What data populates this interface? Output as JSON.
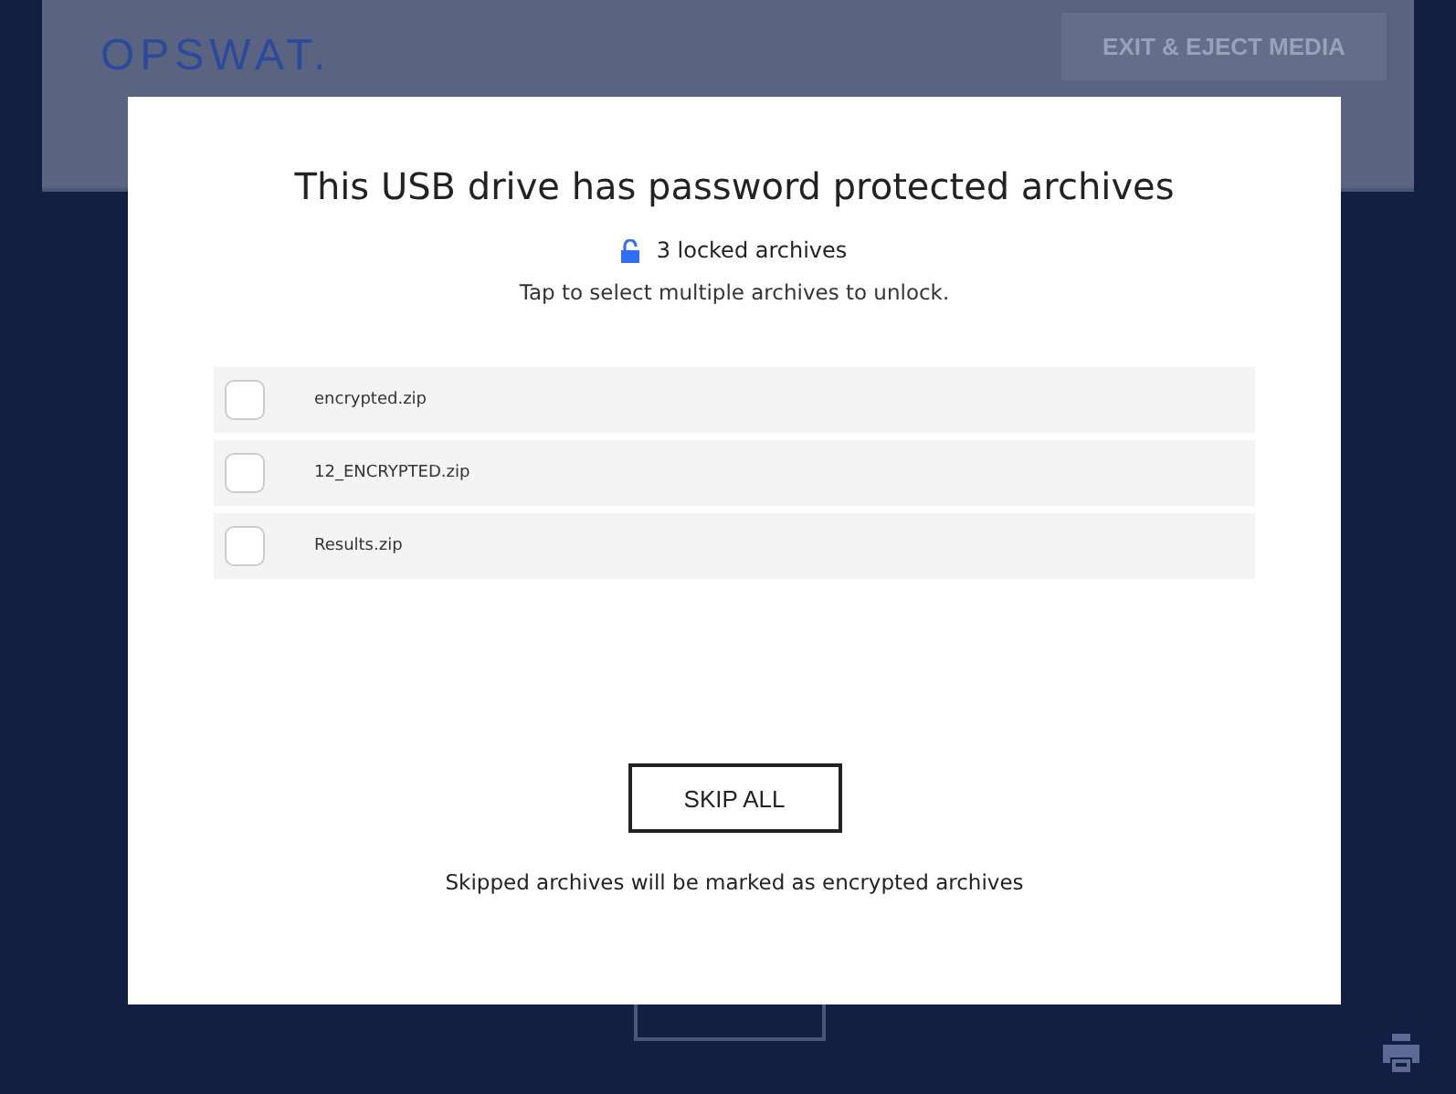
{
  "header": {
    "logo": "OPSWAT.",
    "exit_button": "EXIT & EJECT MEDIA"
  },
  "dialog": {
    "title": "This USB drive has password protected archives",
    "locked_count": "3 locked archives",
    "instruction": "Tap to select multiple archives to unlock.",
    "archives": [
      {
        "name": "encrypted.zip",
        "checked": false
      },
      {
        "name": "12_ENCRYPTED.zip",
        "checked": false
      },
      {
        "name": "Results.zip",
        "checked": false
      }
    ],
    "skip_button": "SKIP ALL",
    "note": "Skipped archives will be marked as encrypted archives"
  }
}
